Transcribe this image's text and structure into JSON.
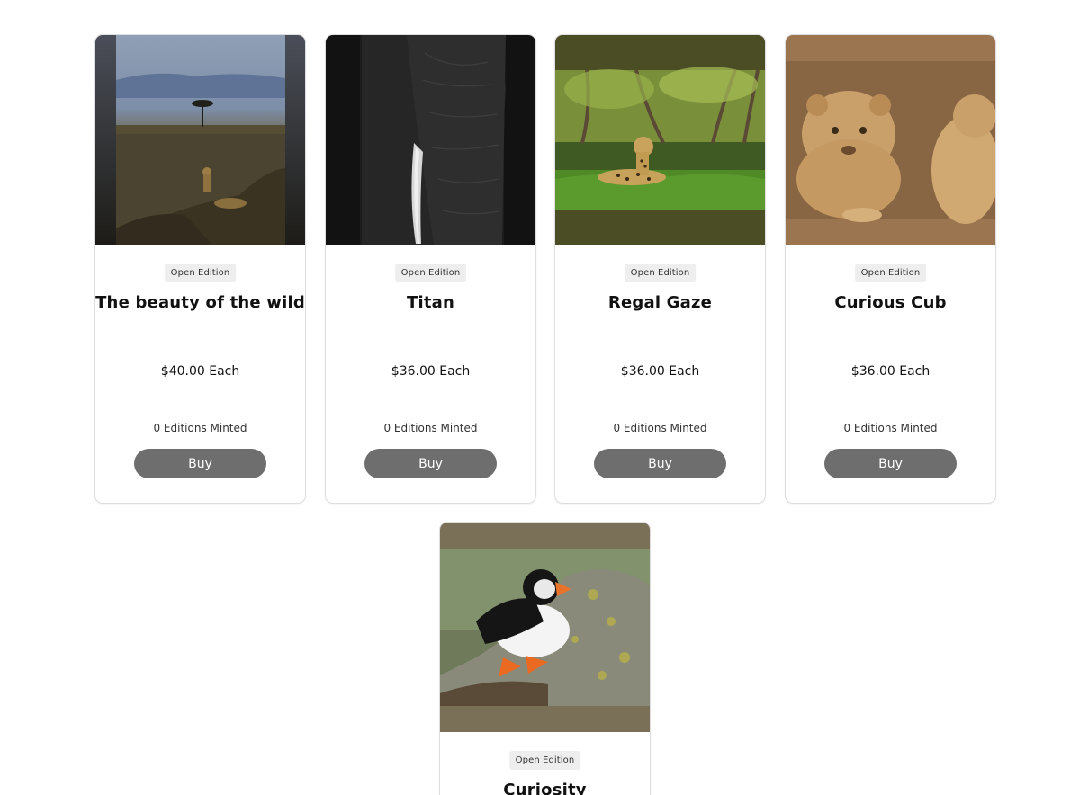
{
  "artworks": [
    {
      "edition": "Open Edition",
      "title": "The beauty of the wild",
      "price": "$40.00 Each",
      "minted": "0 Editions Minted",
      "buy_label": "Buy",
      "image": "cheetah-savanna-photo"
    },
    {
      "edition": "Open Edition",
      "title": "Titan",
      "price": "$36.00 Each",
      "minted": "0 Editions Minted",
      "buy_label": "Buy",
      "image": "elephant-photo"
    },
    {
      "edition": "Open Edition",
      "title": "Regal Gaze",
      "price": "$36.00 Each",
      "minted": "0 Editions Minted",
      "buy_label": "Buy",
      "image": "leopard-photo"
    },
    {
      "edition": "Open Edition",
      "title": "Curious Cub",
      "price": "$36.00 Each",
      "minted": "0 Editions Minted",
      "buy_label": "Buy",
      "image": "lion-cub-photo"
    },
    {
      "edition": "Open Edition",
      "title": "Curiosity",
      "image": "puffin-photo"
    }
  ],
  "colors": {
    "button": "#6e6e6e",
    "badge_bg": "#eeeeee",
    "card_border": "#dedede"
  }
}
